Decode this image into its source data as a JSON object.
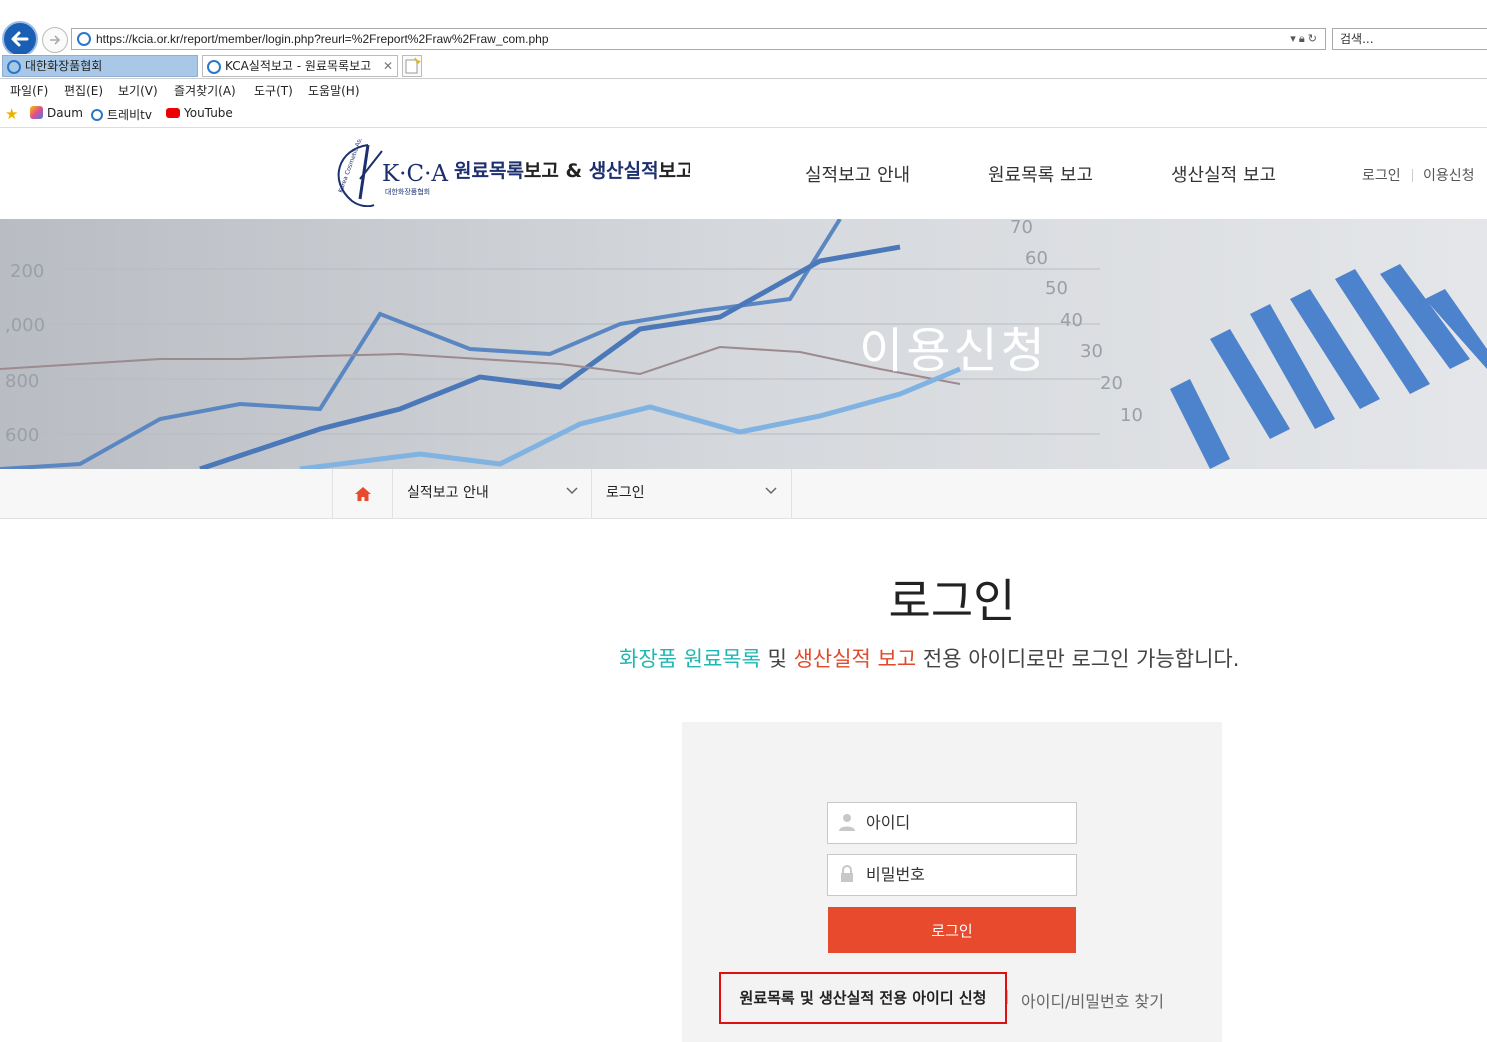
{
  "browser": {
    "url": "https://kcia.or.kr/report/member/login.php?reurl=%2Freport%2Fraw%2Fraw_com.php",
    "search_placeholder": "검색...",
    "tabs": [
      {
        "label": "대한화장품협회",
        "active": false
      },
      {
        "label": "KCA실적보고 - 원료목록보고",
        "active": true
      }
    ],
    "menu": [
      "파일(F)",
      "편집(E)",
      "보기(V)",
      "즐겨찾기(A)",
      "도구(T)",
      "도움말(H)"
    ],
    "favorites": [
      "Daum",
      "트레비tv",
      "YouTube"
    ]
  },
  "site": {
    "logo": {
      "mark": "K·C·A",
      "sub": "대한화장품협회",
      "title_part1": "원료목록",
      "title_part2": "보고 & ",
      "title_part3": "생산실적",
      "title_part4": "보고",
      "ring_text": "Korea Cosmetic Association"
    },
    "gnb": [
      "실적보고 안내",
      "원료목록 보고",
      "생산실적 보고"
    ],
    "util": {
      "login": "로그인",
      "signup": "이용신청"
    },
    "hero_title": "이용신청",
    "breadcrumb": {
      "level1": "실적보고 안내",
      "level2": "로그인"
    }
  },
  "login": {
    "title": "로그인",
    "notice_part1": "화장품 원료목록",
    "notice_part2": " 및 ",
    "notice_part3": "생산실적 보고",
    "notice_part4": " 전용 아이디로만 로그인 가능합니다.",
    "id_placeholder": "아이디",
    "pw_placeholder": "비밀번호",
    "login_button": "로그인",
    "signup_link": "원료목록 및 생산실적 전용 아이디 신청",
    "find_link": "아이디/비밀번호 찾기"
  },
  "colors": {
    "accent_red": "#e84a2e",
    "teal": "#1fb7b0",
    "navy": "#1c2f6e",
    "highlight_box": "#e01010"
  }
}
